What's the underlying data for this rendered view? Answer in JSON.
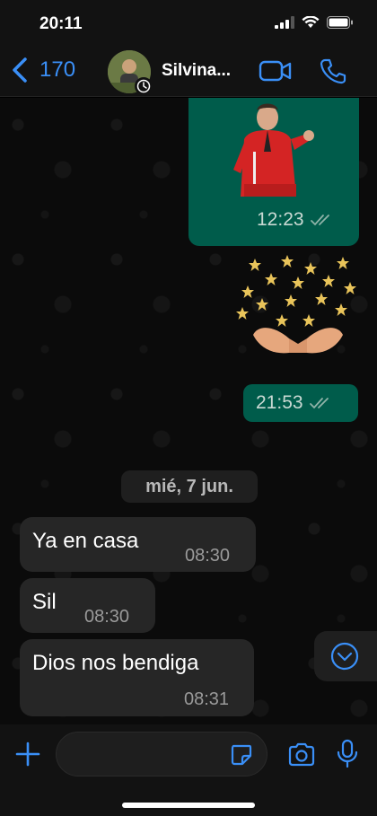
{
  "status_bar": {
    "time": "20:11"
  },
  "header": {
    "back_count": "170",
    "contact_name": "Silvina..."
  },
  "messages": {
    "sticker1_time": "12:23",
    "sticker2_time": "21:53",
    "date_separator": "mié, 7 jun.",
    "incoming": [
      {
        "text": "Ya en casa",
        "time": "08:30"
      },
      {
        "text": "Sil",
        "time": "08:30"
      },
      {
        "text": "Dios nos bendiga",
        "time": "08:31"
      }
    ]
  },
  "input": {
    "placeholder": "",
    "value": ""
  },
  "colors": {
    "accent": "#3a8ff7",
    "outgoing_bubble": "#005c4b",
    "incoming_bubble": "#262626",
    "background": "#0b0b0b"
  },
  "icons": [
    "back-chevron-icon",
    "video-call-icon",
    "phone-icon",
    "double-check-icon",
    "chevron-down-icon",
    "plus-icon",
    "sticker-icon",
    "camera-icon",
    "microphone-icon"
  ]
}
